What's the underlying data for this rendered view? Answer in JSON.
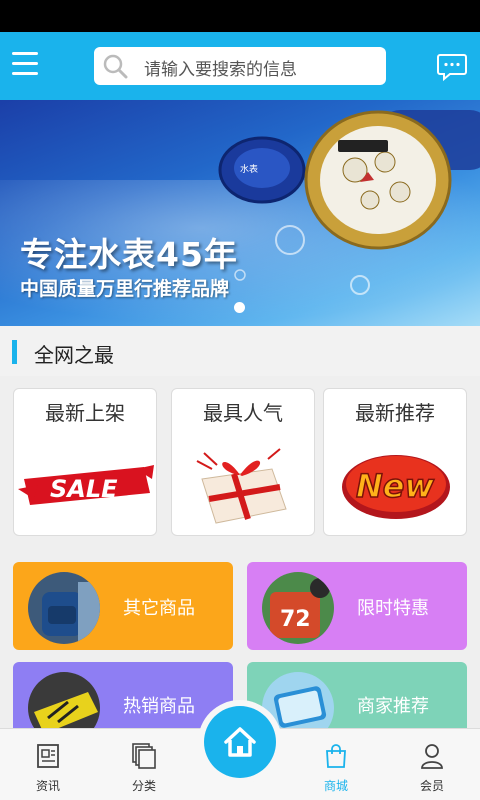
{
  "search": {
    "placeholder": "请输入要搜索的信息"
  },
  "banner": {
    "title": "专注水表45年",
    "subtitle": "中国质量万里行推荐品牌"
  },
  "section": {
    "title": "全网之最"
  },
  "cards": [
    {
      "title": "最新上架",
      "image": "sale-graphic"
    },
    {
      "title": "最具人气",
      "image": "gift-box"
    },
    {
      "title": "最新推荐",
      "image": "new-badge"
    }
  ],
  "tiles": [
    {
      "label": "其它商品",
      "color": "#fca61a"
    },
    {
      "label": "限时特惠",
      "color": "#d77ff4"
    },
    {
      "label": "热销商品",
      "color": "#8e7ef3"
    },
    {
      "label": "商家推荐",
      "color": "#7ed3b8"
    }
  ],
  "tabs": [
    {
      "label": "资讯",
      "icon": "news-icon"
    },
    {
      "label": "分类",
      "icon": "category-icon"
    },
    {
      "label": "商城",
      "icon": "shopping-bag-icon",
      "active": true
    },
    {
      "label": "会员",
      "icon": "member-icon"
    }
  ],
  "colors": {
    "accent": "#1ab3ec",
    "active_tab": "#1ab3ec"
  }
}
